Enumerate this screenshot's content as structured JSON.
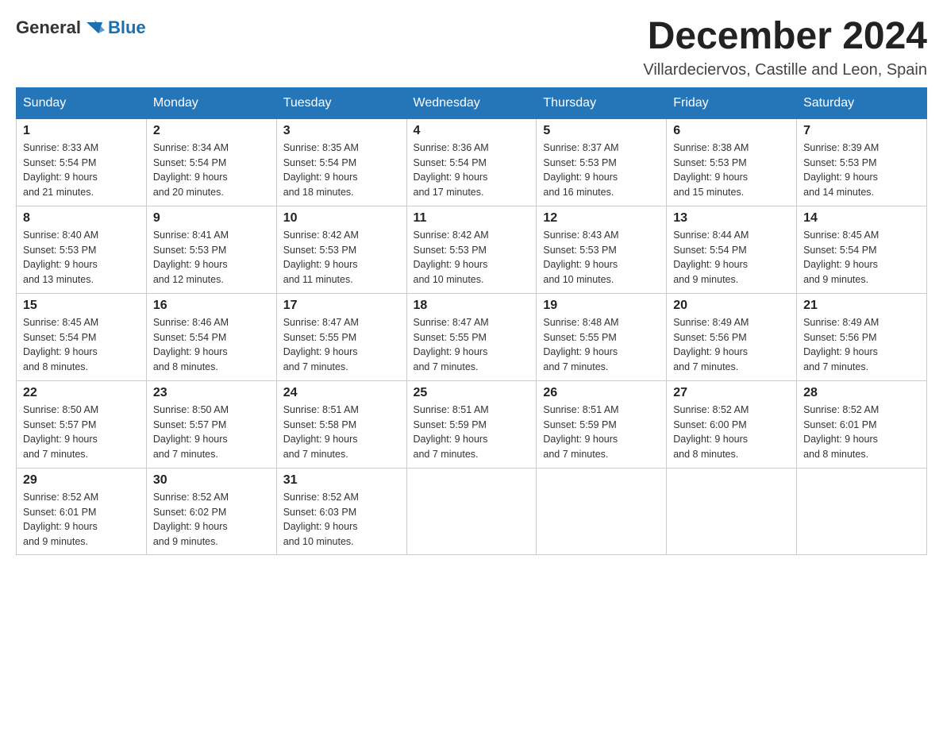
{
  "header": {
    "logo_general": "General",
    "logo_blue": "Blue",
    "month_year": "December 2024",
    "location": "Villardeciervos, Castille and Leon, Spain"
  },
  "weekdays": [
    "Sunday",
    "Monday",
    "Tuesday",
    "Wednesday",
    "Thursday",
    "Friday",
    "Saturday"
  ],
  "weeks": [
    [
      {
        "day": "1",
        "sunrise": "8:33 AM",
        "sunset": "5:54 PM",
        "daylight": "9 hours and 21 minutes."
      },
      {
        "day": "2",
        "sunrise": "8:34 AM",
        "sunset": "5:54 PM",
        "daylight": "9 hours and 20 minutes."
      },
      {
        "day": "3",
        "sunrise": "8:35 AM",
        "sunset": "5:54 PM",
        "daylight": "9 hours and 18 minutes."
      },
      {
        "day": "4",
        "sunrise": "8:36 AM",
        "sunset": "5:54 PM",
        "daylight": "9 hours and 17 minutes."
      },
      {
        "day": "5",
        "sunrise": "8:37 AM",
        "sunset": "5:53 PM",
        "daylight": "9 hours and 16 minutes."
      },
      {
        "day": "6",
        "sunrise": "8:38 AM",
        "sunset": "5:53 PM",
        "daylight": "9 hours and 15 minutes."
      },
      {
        "day": "7",
        "sunrise": "8:39 AM",
        "sunset": "5:53 PM",
        "daylight": "9 hours and 14 minutes."
      }
    ],
    [
      {
        "day": "8",
        "sunrise": "8:40 AM",
        "sunset": "5:53 PM",
        "daylight": "9 hours and 13 minutes."
      },
      {
        "day": "9",
        "sunrise": "8:41 AM",
        "sunset": "5:53 PM",
        "daylight": "9 hours and 12 minutes."
      },
      {
        "day": "10",
        "sunrise": "8:42 AM",
        "sunset": "5:53 PM",
        "daylight": "9 hours and 11 minutes."
      },
      {
        "day": "11",
        "sunrise": "8:42 AM",
        "sunset": "5:53 PM",
        "daylight": "9 hours and 10 minutes."
      },
      {
        "day": "12",
        "sunrise": "8:43 AM",
        "sunset": "5:53 PM",
        "daylight": "9 hours and 10 minutes."
      },
      {
        "day": "13",
        "sunrise": "8:44 AM",
        "sunset": "5:54 PM",
        "daylight": "9 hours and 9 minutes."
      },
      {
        "day": "14",
        "sunrise": "8:45 AM",
        "sunset": "5:54 PM",
        "daylight": "9 hours and 9 minutes."
      }
    ],
    [
      {
        "day": "15",
        "sunrise": "8:45 AM",
        "sunset": "5:54 PM",
        "daylight": "9 hours and 8 minutes."
      },
      {
        "day": "16",
        "sunrise": "8:46 AM",
        "sunset": "5:54 PM",
        "daylight": "9 hours and 8 minutes."
      },
      {
        "day": "17",
        "sunrise": "8:47 AM",
        "sunset": "5:55 PM",
        "daylight": "9 hours and 7 minutes."
      },
      {
        "day": "18",
        "sunrise": "8:47 AM",
        "sunset": "5:55 PM",
        "daylight": "9 hours and 7 minutes."
      },
      {
        "day": "19",
        "sunrise": "8:48 AM",
        "sunset": "5:55 PM",
        "daylight": "9 hours and 7 minutes."
      },
      {
        "day": "20",
        "sunrise": "8:49 AM",
        "sunset": "5:56 PM",
        "daylight": "9 hours and 7 minutes."
      },
      {
        "day": "21",
        "sunrise": "8:49 AM",
        "sunset": "5:56 PM",
        "daylight": "9 hours and 7 minutes."
      }
    ],
    [
      {
        "day": "22",
        "sunrise": "8:50 AM",
        "sunset": "5:57 PM",
        "daylight": "9 hours and 7 minutes."
      },
      {
        "day": "23",
        "sunrise": "8:50 AM",
        "sunset": "5:57 PM",
        "daylight": "9 hours and 7 minutes."
      },
      {
        "day": "24",
        "sunrise": "8:51 AM",
        "sunset": "5:58 PM",
        "daylight": "9 hours and 7 minutes."
      },
      {
        "day": "25",
        "sunrise": "8:51 AM",
        "sunset": "5:59 PM",
        "daylight": "9 hours and 7 minutes."
      },
      {
        "day": "26",
        "sunrise": "8:51 AM",
        "sunset": "5:59 PM",
        "daylight": "9 hours and 7 minutes."
      },
      {
        "day": "27",
        "sunrise": "8:52 AM",
        "sunset": "6:00 PM",
        "daylight": "9 hours and 8 minutes."
      },
      {
        "day": "28",
        "sunrise": "8:52 AM",
        "sunset": "6:01 PM",
        "daylight": "9 hours and 8 minutes."
      }
    ],
    [
      {
        "day": "29",
        "sunrise": "8:52 AM",
        "sunset": "6:01 PM",
        "daylight": "9 hours and 9 minutes."
      },
      {
        "day": "30",
        "sunrise": "8:52 AM",
        "sunset": "6:02 PM",
        "daylight": "9 hours and 9 minutes."
      },
      {
        "day": "31",
        "sunrise": "8:52 AM",
        "sunset": "6:03 PM",
        "daylight": "9 hours and 10 minutes."
      },
      null,
      null,
      null,
      null
    ]
  ]
}
